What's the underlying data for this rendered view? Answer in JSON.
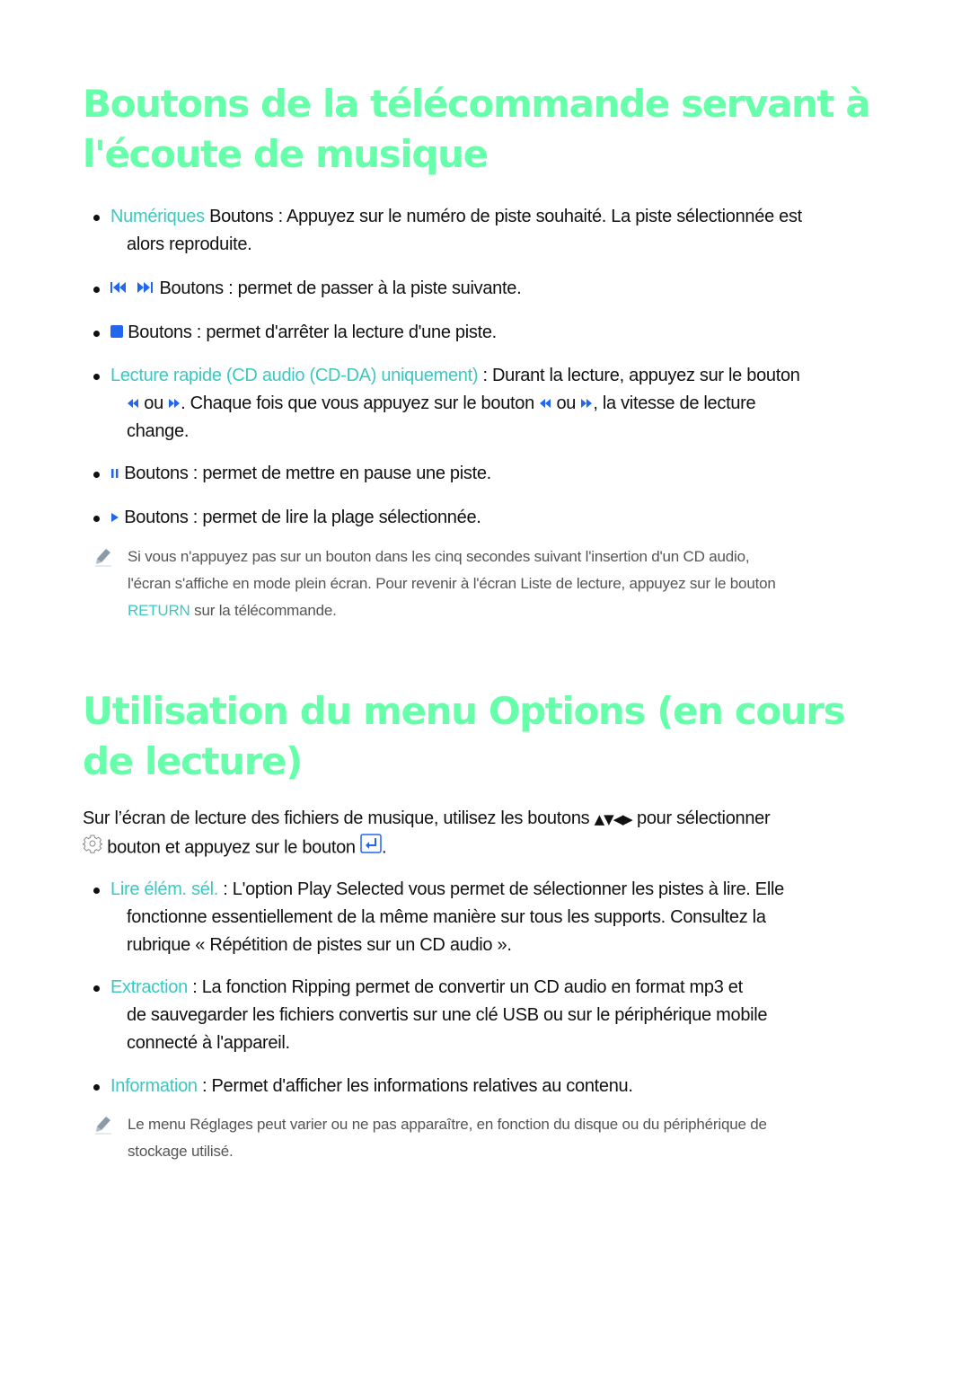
{
  "section1": {
    "title": "Boutons de la télécommande servant à l'écoute de musique",
    "items": [
      {
        "label": "Numériques",
        "text1": " Boutons : Appuyez sur le numéro de piste souhaité. La piste sélectionnée est",
        "text2": "alors reproduite."
      },
      {
        "icon": "skip-prev-next-icons",
        "text": " Boutons : permet de passer à la piste suivante."
      },
      {
        "icon": "stop-icon",
        "text": " Boutons : permet d'arrêter la lecture d'une piste."
      },
      {
        "label": "Lecture rapide (CD audio (CD-DA) uniquement)",
        "text1": " : Durant la lecture, appuyez sur le bouton",
        "or1": " ou ",
        "text2": ". Chaque fois que vous appuyez sur le bouton ",
        "or2": " ou ",
        "text3": ", la vitesse de lecture",
        "text4": "change."
      },
      {
        "icon": "pause-icon",
        "text": " Boutons : permet de mettre en pause une piste."
      },
      {
        "icon": "play-icon",
        "text": " Boutons : permet de lire la plage sélectionnée."
      }
    ],
    "note": {
      "line1": "Si vous n'appuyez pas sur un bouton dans les cinq secondes suivant l'insertion d'un CD audio,",
      "line2": "l'écran s'affiche en mode plein écran. Pour revenir à l'écran Liste de lecture, appuyez sur le bouton",
      "label": "RETURN",
      "line3": " sur la télécommande."
    }
  },
  "section2": {
    "title": "Utilisation du menu Options (en cours de lecture)",
    "intro": {
      "text1": "Sur l’écran de lecture des fichiers de musique, utilisez les boutons ",
      "arrows": "▲▼◀▶",
      "text2": " pour sélectionner",
      "text3": " bouton et appuyez sur le bouton ",
      "text4": "."
    },
    "items": [
      {
        "label": "Lire élém. sél.",
        "text1": " : L'option Play Selected vous permet de sélectionner les pistes à lire. Elle",
        "text2": "fonctionne essentiellement de la même manière sur tous les supports. Consultez la",
        "text3": "rubrique « Répétition de pistes sur un CD audio »."
      },
      {
        "label": "Extraction",
        "text1": " : La fonction Ripping permet de convertir un CD audio en format mp3 et",
        "text2": "de sauvegarder les fichiers convertis sur une clé USB ou sur le périphérique mobile",
        "text3": "connecté à l'appareil."
      },
      {
        "label": "Information",
        "text1": " : Permet d'afficher les informations relatives au contenu."
      }
    ],
    "note": {
      "line1": "Le menu Réglages peut varier ou ne pas apparaître, en fonction du disque ou du périphérique de",
      "line2": "stockage utilisé."
    }
  },
  "colors": {
    "heading": "#66ffaa",
    "highlight": "#3cc8c0",
    "icon_blue": "#2266ee"
  }
}
